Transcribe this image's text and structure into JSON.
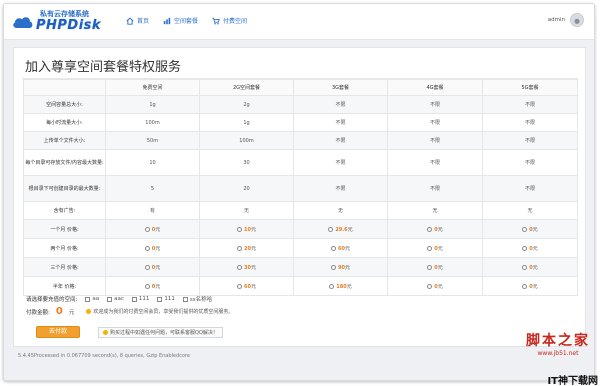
{
  "header": {
    "slogan": "私有云存储系统",
    "brand": "PHPDisk",
    "nav": [
      {
        "label": "首页",
        "icon": "home-icon"
      },
      {
        "label": "空间套餐",
        "icon": "chart-icon"
      },
      {
        "label": "付费空间",
        "icon": "cart-icon"
      }
    ],
    "user": "admin"
  },
  "page": {
    "title": "加入尊享空间套餐特权服务"
  },
  "table": {
    "columns": [
      "",
      "免费空间",
      "2G空间套餐",
      "3G套餐",
      "4G套餐",
      "5G套餐"
    ],
    "rows": [
      {
        "label": "空间容量总大小:",
        "cells": [
          "1g",
          "2g",
          "不限",
          "不限",
          "不限"
        ]
      },
      {
        "label": "每小时流量大小:",
        "cells": [
          "100m",
          "1g",
          "不限",
          "不限",
          "不限"
        ]
      },
      {
        "label": "上传单个文件大小:",
        "cells": [
          "50m",
          "100m",
          "不限",
          "不限",
          "不限"
        ]
      },
      {
        "label": "每个目录可存放文件/内容最大数量:",
        "cells": [
          "10",
          "30",
          "不限",
          "不限",
          "不限"
        ]
      },
      {
        "label": "根目录下可创建目录的最大数量:",
        "cells": [
          "5",
          "20",
          "不限",
          "不限",
          "不限"
        ]
      },
      {
        "label": "含有广告:",
        "cells": [
          "有",
          "无",
          "无",
          "无",
          "无"
        ]
      }
    ],
    "price_rows": [
      {
        "label": "一个月 价格:",
        "prices": [
          "0",
          "10",
          "29.6",
          "0",
          "0"
        ]
      },
      {
        "label": "两个月 价格:",
        "prices": [
          "0",
          "20",
          "60",
          "0",
          "0"
        ]
      },
      {
        "label": "三个月 价格:",
        "prices": [
          "0",
          "30",
          "90",
          "0",
          "0"
        ]
      },
      {
        "label": "半年 价格:",
        "prices": [
          "0",
          "60",
          "180",
          "0",
          "0"
        ]
      }
    ],
    "price_unit": "元"
  },
  "space_select": {
    "label": "请选择要充值的空间:",
    "options": [
      "aa",
      "aac",
      "111",
      "111",
      "ss名称哈"
    ]
  },
  "total": {
    "label": "付款金额:",
    "amount": "0",
    "unit": "元",
    "notice": "欢迎成为我们的付费空间会员，享受我们提供的优质空间服务。"
  },
  "pay_button": "去付款",
  "help_text": "购买过程中如遇任何问题，可联系客服QQ解决！",
  "footer": "5.4.45Processed in 0.067709 second(s), 8 queries, Gzip Enabledcore",
  "watermark": {
    "cn": "脚本之家",
    "url": "www.jb51.net",
    "corner": "IT神下载网"
  },
  "colors": {
    "accent": "#2a6fc9",
    "price": "#e67e22",
    "button": "#f0a030",
    "watermark": "#c9261c"
  }
}
